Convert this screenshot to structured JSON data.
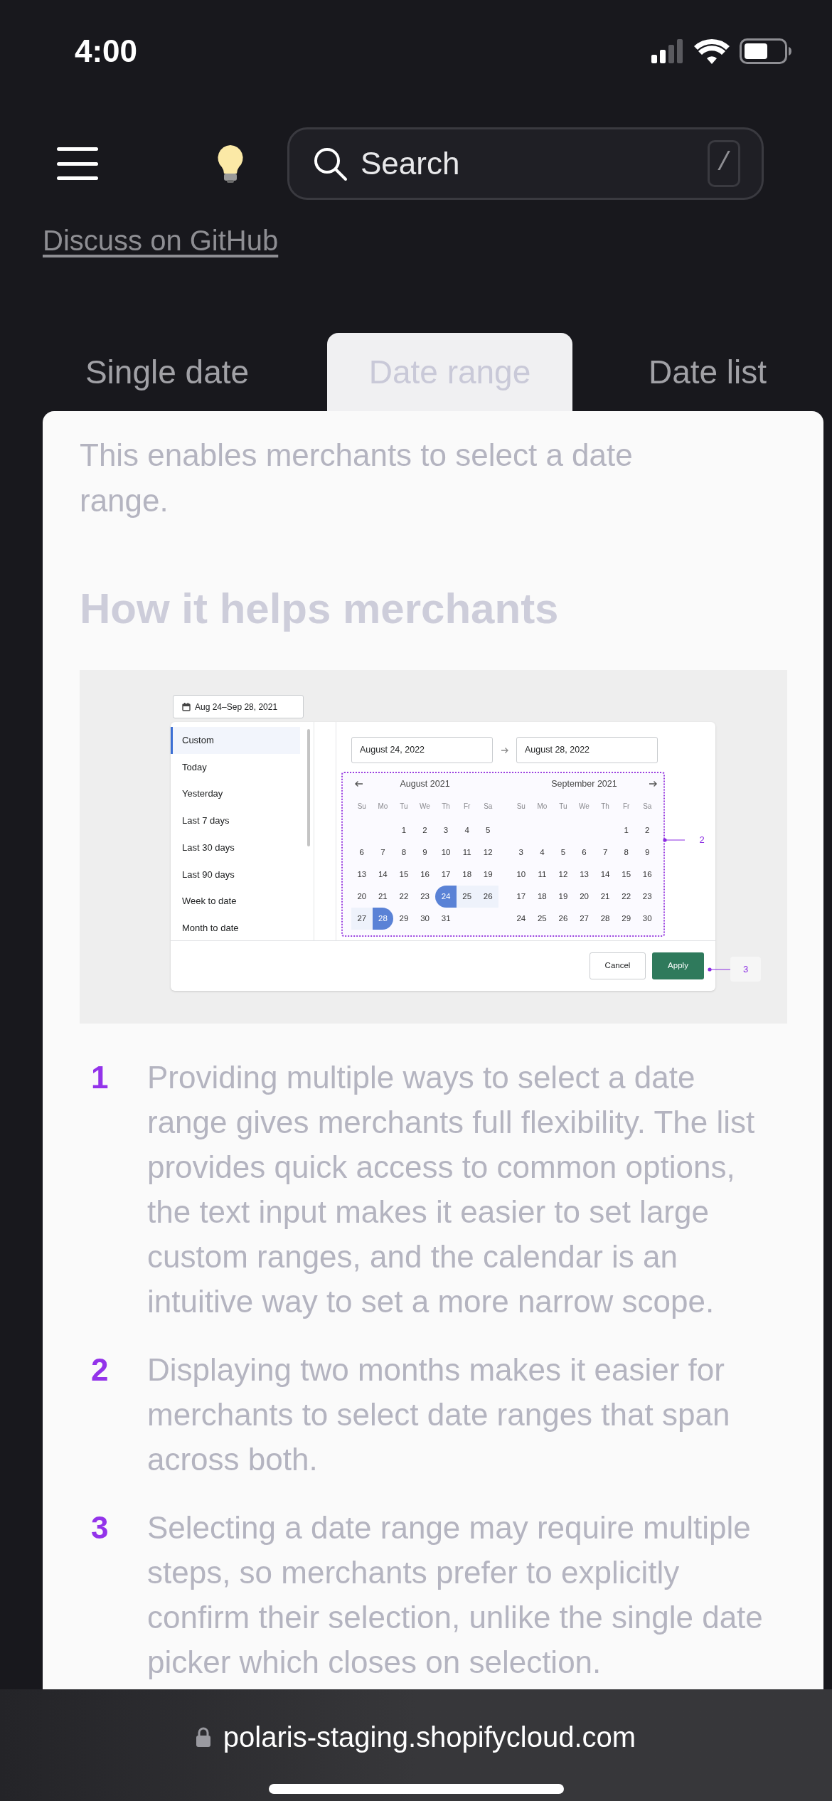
{
  "status_bar": {
    "time": "4:00"
  },
  "header": {
    "search": {
      "placeholder": "Search",
      "shortcut": "/"
    },
    "link": "Discuss on GitHub"
  },
  "tabs": [
    {
      "label": "Single date",
      "selected": false
    },
    {
      "label": "Date range",
      "selected": true
    },
    {
      "label": "Date list",
      "selected": false
    }
  ],
  "intro": "This enables merchants to select a date range.",
  "heading": "How it helps merchants",
  "illustration": {
    "date_button": "Aug 24–Sep 28, 2021",
    "presets": [
      {
        "label": "Custom",
        "selected": true
      },
      {
        "label": "Today",
        "selected": false
      },
      {
        "label": "Yesterday",
        "selected": false
      },
      {
        "label": "Last 7 days",
        "selected": false
      },
      {
        "label": "Last 30 days",
        "selected": false
      },
      {
        "label": "Last 90 days",
        "selected": false
      },
      {
        "label": "Week to date",
        "selected": false
      },
      {
        "label": "Month to date",
        "selected": false
      }
    ],
    "start_field": "August 24, 2022",
    "end_field": "August 28, 2022",
    "months": [
      {
        "title": "August 2021",
        "weekdays": [
          "Su",
          "Mo",
          "Tu",
          "We",
          "Th",
          "Fr",
          "Sa"
        ],
        "weeks": [
          [
            {
              "label": "1",
              "start": false,
              "end": false,
              "in_range": false
            },
            {
              "label": "2",
              "start": false,
              "end": false,
              "in_range": false
            },
            {
              "label": "3",
              "start": false,
              "end": false,
              "in_range": false
            },
            {
              "label": "4",
              "start": false,
              "end": false,
              "in_range": false
            },
            {
              "label": "5",
              "start": false,
              "end": false,
              "in_range": false
            }
          ],
          [
            {
              "label": "6",
              "start": false,
              "end": false,
              "in_range": false
            },
            {
              "label": "7",
              "start": false,
              "end": false,
              "in_range": false
            },
            {
              "label": "8",
              "start": false,
              "end": false,
              "in_range": false
            },
            {
              "label": "9",
              "start": false,
              "end": false,
              "in_range": false
            },
            {
              "label": "10",
              "start": false,
              "end": false,
              "in_range": false
            },
            {
              "label": "11",
              "start": false,
              "end": false,
              "in_range": false
            },
            {
              "label": "12",
              "start": false,
              "end": false,
              "in_range": false
            }
          ],
          [
            {
              "label": "13",
              "start": false,
              "end": false,
              "in_range": false
            },
            {
              "label": "14",
              "start": false,
              "end": false,
              "in_range": false
            },
            {
              "label": "15",
              "start": false,
              "end": false,
              "in_range": false
            },
            {
              "label": "16",
              "start": false,
              "end": false,
              "in_range": false
            },
            {
              "label": "17",
              "start": false,
              "end": false,
              "in_range": false
            },
            {
              "label": "18",
              "start": false,
              "end": false,
              "in_range": false
            },
            {
              "label": "19",
              "start": false,
              "end": false,
              "in_range": false
            }
          ],
          [
            {
              "label": "20",
              "start": false,
              "end": false,
              "in_range": false
            },
            {
              "label": "21",
              "start": false,
              "end": false,
              "in_range": false
            },
            {
              "label": "22",
              "start": false,
              "end": false,
              "in_range": false
            },
            {
              "label": "23",
              "start": false,
              "end": false,
              "in_range": false
            },
            {
              "label": "24",
              "start": true,
              "end": false,
              "in_range": true
            },
            {
              "label": "25",
              "start": false,
              "end": false,
              "in_range": true
            },
            {
              "label": "26",
              "start": false,
              "end": false,
              "in_range": true
            }
          ],
          [
            {
              "label": "27",
              "start": false,
              "end": false,
              "in_range": true
            },
            {
              "label": "28",
              "start": false,
              "end": true,
              "in_range": true
            },
            {
              "label": "29",
              "start": false,
              "end": false,
              "in_range": false
            },
            {
              "label": "30",
              "start": false,
              "end": false,
              "in_range": false
            },
            {
              "label": "31",
              "start": false,
              "end": false,
              "in_range": false
            }
          ]
        ]
      },
      {
        "title": "September 2021",
        "weekdays": [
          "Su",
          "Mo",
          "Tu",
          "We",
          "Th",
          "Fr",
          "Sa"
        ],
        "weeks": [
          [
            {
              "label": "1",
              "start": false,
              "end": false,
              "in_range": false
            },
            {
              "label": "2",
              "start": false,
              "end": false,
              "in_range": false
            }
          ],
          [
            {
              "label": "3",
              "start": false,
              "end": false,
              "in_range": false
            },
            {
              "label": "4",
              "start": false,
              "end": false,
              "in_range": false
            },
            {
              "label": "5",
              "start": false,
              "end": false,
              "in_range": false
            },
            {
              "label": "6",
              "start": false,
              "end": false,
              "in_range": false
            },
            {
              "label": "7",
              "start": false,
              "end": false,
              "in_range": false
            },
            {
              "label": "8",
              "start": false,
              "end": false,
              "in_range": false
            },
            {
              "label": "9",
              "start": false,
              "end": false,
              "in_range": false
            }
          ],
          [
            {
              "label": "10",
              "start": false,
              "end": false,
              "in_range": false
            },
            {
              "label": "11",
              "start": false,
              "end": false,
              "in_range": false
            },
            {
              "label": "12",
              "start": false,
              "end": false,
              "in_range": false
            },
            {
              "label": "13",
              "start": false,
              "end": false,
              "in_range": false
            },
            {
              "label": "14",
              "start": false,
              "end": false,
              "in_range": false
            },
            {
              "label": "15",
              "start": false,
              "end": false,
              "in_range": false
            },
            {
              "label": "16",
              "start": false,
              "end": false,
              "in_range": false
            }
          ],
          [
            {
              "label": "17",
              "start": false,
              "end": false,
              "in_range": false
            },
            {
              "label": "18",
              "start": false,
              "end": false,
              "in_range": false
            },
            {
              "label": "19",
              "start": false,
              "end": false,
              "in_range": false
            },
            {
              "label": "20",
              "start": false,
              "end": false,
              "in_range": false
            },
            {
              "label": "21",
              "start": false,
              "end": false,
              "in_range": false
            },
            {
              "label": "22",
              "start": false,
              "end": false,
              "in_range": false
            },
            {
              "label": "23",
              "start": false,
              "end": false,
              "in_range": false
            }
          ],
          [
            {
              "label": "24",
              "start": false,
              "end": false,
              "in_range": false
            },
            {
              "label": "25",
              "start": false,
              "end": false,
              "in_range": false
            },
            {
              "label": "26",
              "start": false,
              "end": false,
              "in_range": false
            },
            {
              "label": "27",
              "start": false,
              "end": false,
              "in_range": false
            },
            {
              "label": "28",
              "start": false,
              "end": false,
              "in_range": false
            },
            {
              "label": "29",
              "start": false,
              "end": false,
              "in_range": false
            },
            {
              "label": "30",
              "start": false,
              "end": false,
              "in_range": false
            }
          ]
        ]
      }
    ],
    "callout_calendar": "2",
    "cancel": "Cancel",
    "apply": "Apply",
    "callout_apply": "3"
  },
  "notes": [
    {
      "number": "1",
      "text": "Providing multiple ways to select a date range gives merchants full flexibility. The list provides quick access to common options, the text input makes it easier to set large custom ranges, and the calendar is an intuitive way to set a more narrow scope."
    },
    {
      "number": "2",
      "text": "Displaying two months makes it easier for merchants to select date ranges that span across both."
    },
    {
      "number": "3",
      "text": "Selecting a date range may require multiple steps, so merchants prefer to explicitly confirm their selection, unlike the single date picker which closes on selection."
    }
  ],
  "browser": {
    "url": "polaris-staging.shopifycloud.com"
  }
}
